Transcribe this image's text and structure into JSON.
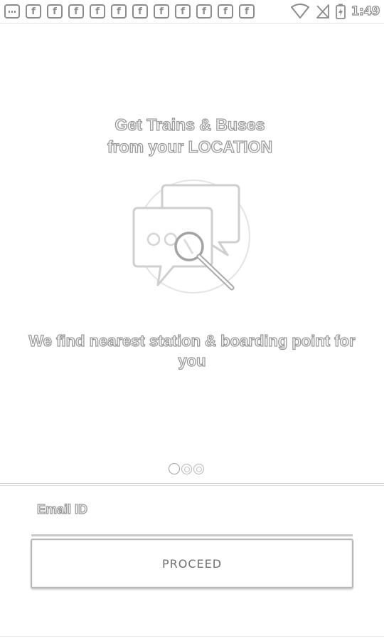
{
  "status_bar": {
    "notification_icons": [
      {
        "icon": "more-notifications-icon",
        "glyph": ""
      },
      {
        "icon": "facebook-icon",
        "glyph": "f"
      },
      {
        "icon": "facebook-icon",
        "glyph": "f"
      },
      {
        "icon": "facebook-icon",
        "glyph": "f"
      },
      {
        "icon": "facebook-icon",
        "glyph": "f"
      },
      {
        "icon": "facebook-icon",
        "glyph": "f"
      },
      {
        "icon": "facebook-icon",
        "glyph": "f"
      },
      {
        "icon": "facebook-icon",
        "glyph": "f"
      },
      {
        "icon": "facebook-icon",
        "glyph": "f"
      },
      {
        "icon": "facebook-icon",
        "glyph": "f"
      },
      {
        "icon": "facebook-icon",
        "glyph": "f"
      },
      {
        "icon": "facebook-icon",
        "glyph": "f"
      }
    ],
    "wifi_icon": "wifi-icon",
    "signal_icon": "no-signal-icon",
    "battery_icon": "battery-charging-icon",
    "time": "1:49"
  },
  "onboarding": {
    "headline_line1": "Get Trains  & Buses",
    "headline_line2": "from your LOCATION",
    "illustration_icon": "chat-search-icon",
    "subtitle": "We find nearest station & boarding point for you",
    "page_count": 3,
    "current_page": 1
  },
  "form": {
    "email_label": "Email ID",
    "email_value": "",
    "proceed_label": "PROCEED"
  }
}
